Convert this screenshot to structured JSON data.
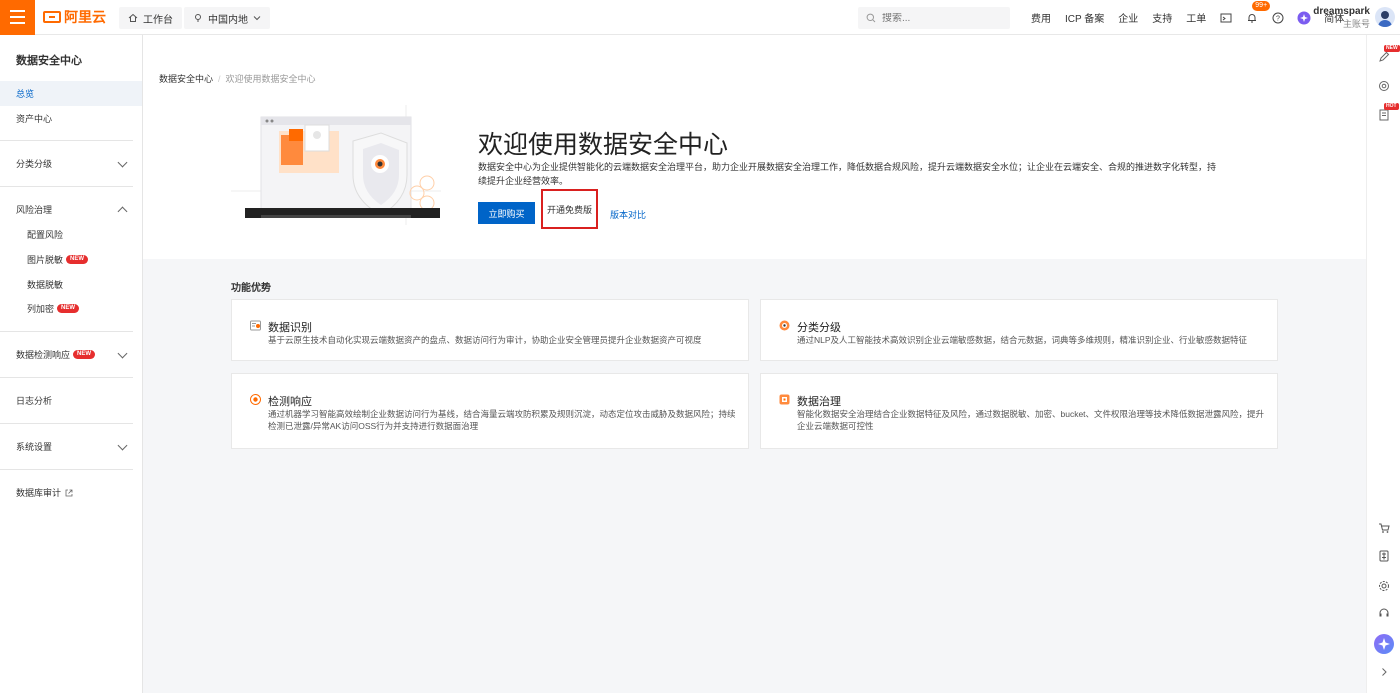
{
  "topbar": {
    "brand": "阿里云",
    "workbench": "工作台",
    "region": "中国内地",
    "search_placeholder": "搜索...",
    "links": [
      "费用",
      "ICP 备案",
      "企业",
      "支持",
      "工单"
    ],
    "notification_badge": "99+",
    "language": "简体",
    "user_name": "dreamspark",
    "user_role": "主账号"
  },
  "sidebar": {
    "title": "数据安全中心",
    "items": {
      "overview": "总览",
      "asset_center": "资产中心",
      "classification": "分类分级",
      "risk_governance": "风险治理",
      "config_risk": "配置风险",
      "image_desensitize": "图片脱敏",
      "data_desensitize": "数据脱敏",
      "column_encrypt": "列加密",
      "detect_response": "数据检测响应",
      "log_analysis": "日志分析",
      "system_settings": "系统设置",
      "db_audit": "数据库审计"
    },
    "new_tag": "NEW"
  },
  "breadcrumb": {
    "root": "数据安全中心",
    "separator": "/",
    "current": "欢迎使用数据安全中心"
  },
  "hero": {
    "title": "欢迎使用数据安全中心",
    "description": "数据安全中心为企业提供智能化的云端数据安全治理平台，助力企业开展数据安全治理工作，降低数据合规风险，提升云端数据安全水位；让企业在云端安全、合规的推进数字化转型，持续提升企业经营效率。",
    "buy_label": "立即购买",
    "free_label": "开通免费版",
    "compare_label": "版本对比"
  },
  "features": {
    "title": "功能优势",
    "cards": [
      {
        "title": "数据识别",
        "desc": "基于云原生技术自动化实现云端数据资产的盘点、数据访问行为审计，协助企业安全管理员提升企业数据资产可视度"
      },
      {
        "title": "分类分级",
        "desc": "通过NLP及人工智能技术高效识别企业云端敏感数据，结合元数据，词典等多维规则，精准识别企业、行业敏感数据特征"
      },
      {
        "title": "检测响应",
        "desc": "通过机器学习智能高效绘制企业数据访问行为基线，结合海量云端攻防积累及规则沉淀，动态定位攻击威胁及数据风险；持续检测已泄露/异常AK访问OSS行为并支持进行数据面治理"
      },
      {
        "title": "数据治理",
        "desc": "智能化数据安全治理结合企业数据特征及风险，通过数据脱敏、加密、bucket、文件权限治理等技术降低数据泄露风险，提升企业云端数据可控性"
      }
    ]
  },
  "rail": {
    "new_tag": "NEW",
    "hot_tag": "HOT"
  },
  "colors": {
    "brand": "#ff6a00",
    "primary": "#0064c8",
    "highlight": "#d9201f"
  }
}
